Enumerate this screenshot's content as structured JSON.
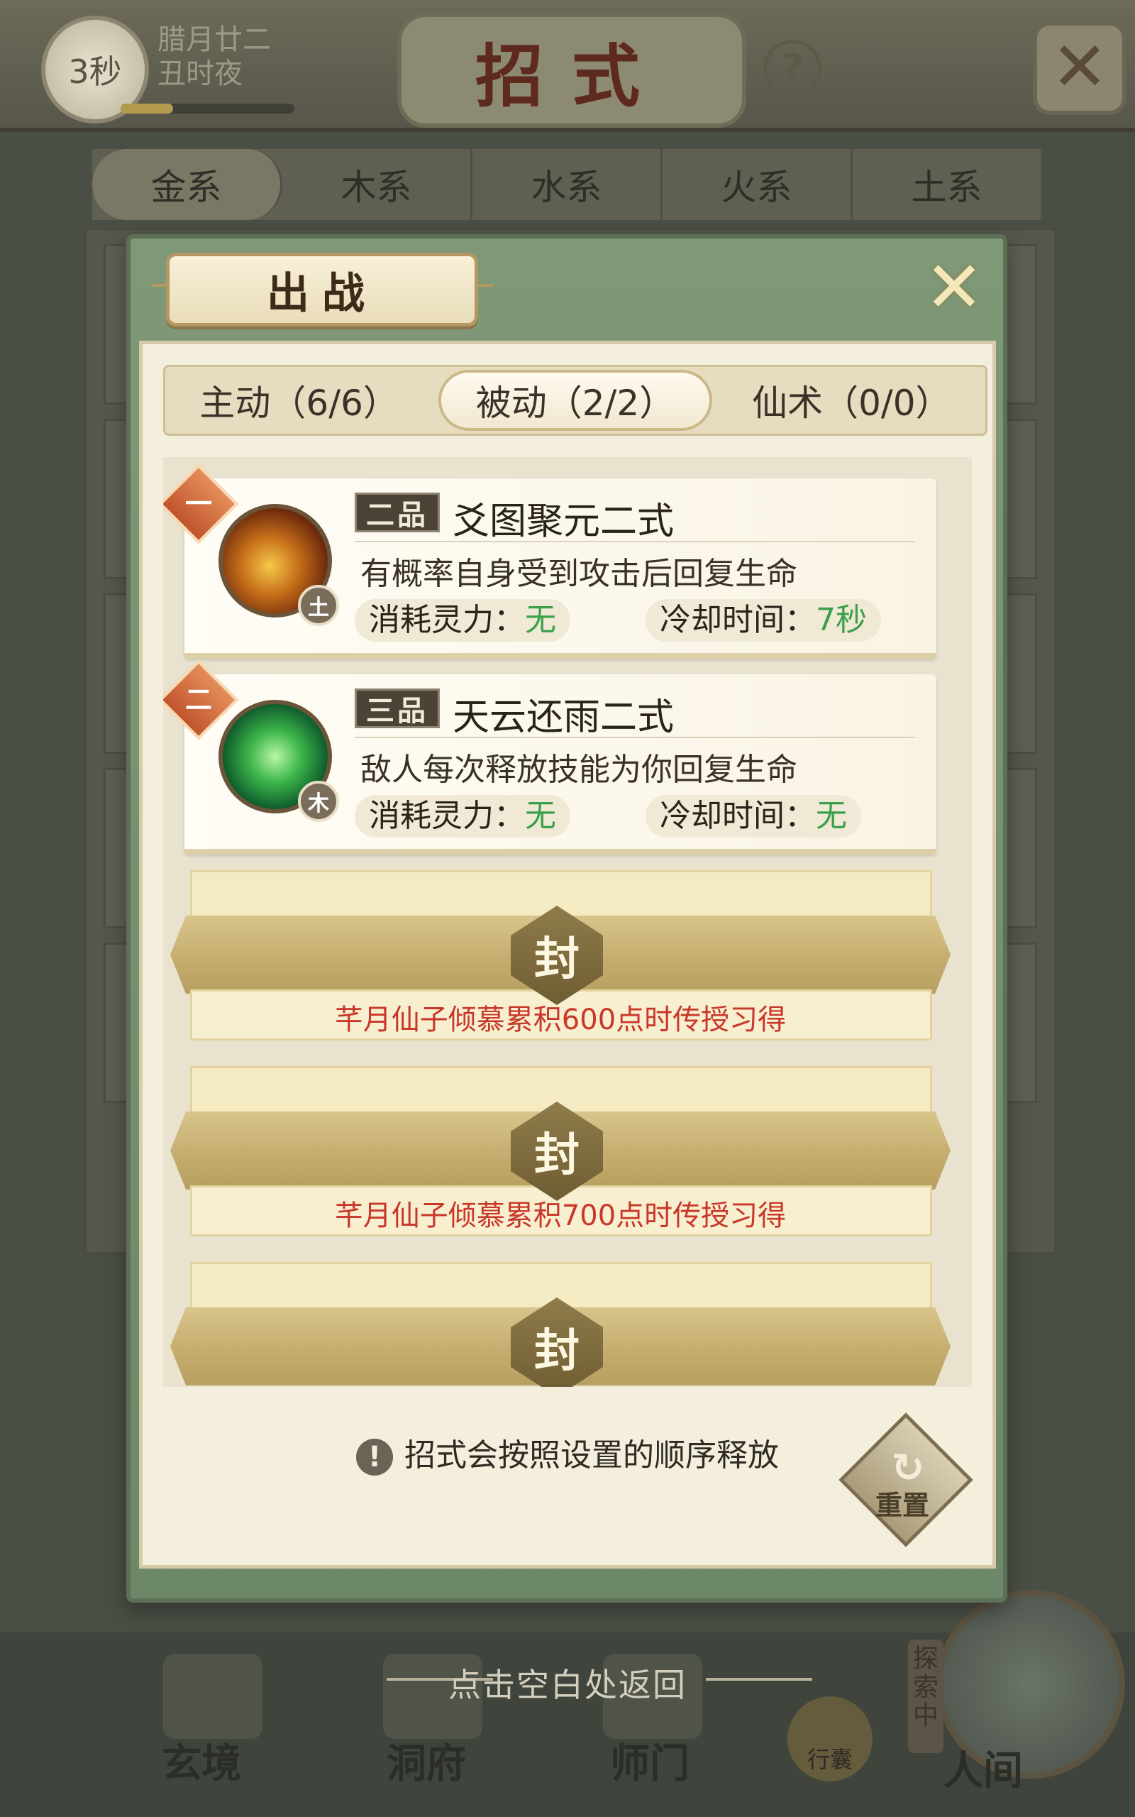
{
  "top_bar": {
    "timer": "3秒",
    "date_line1": "腊月廿二",
    "date_line2": "丑时夜",
    "time_progress": 0.3,
    "title": "招式",
    "help_glyph": "?",
    "close_glyph": "✕"
  },
  "element_tabs": [
    "金系",
    "木系",
    "水系",
    "火系",
    "土系"
  ],
  "modal": {
    "title": "出战",
    "close_glyph": "✕",
    "sub_tabs": [
      "主动（6/6）",
      "被动（2/2）",
      "仙术（0/0）"
    ],
    "active_sub_tab": 1,
    "skills": [
      {
        "order": "一",
        "grade": "二品",
        "name": "爻图聚元二式",
        "element": "土",
        "icon": "earth-skill-icon",
        "description": "有概率自身受到攻击后回复生命",
        "cost_label": "消耗灵力：",
        "cost_value": "无",
        "cooldown_label": "冷却时间：",
        "cooldown_value": "7秒"
      },
      {
        "order": "二",
        "grade": "三品",
        "name": "天云还雨二式",
        "element": "木",
        "icon": "wood-skill-icon",
        "description": "敌人每次释放技能为你回复生命",
        "cost_label": "消耗灵力：",
        "cost_value": "无",
        "cooldown_label": "冷却时间：",
        "cooldown_value": "无"
      }
    ],
    "sealed_slots": [
      {
        "seal": "封",
        "unlock": "芊月仙子倾慕累积600点时传授习得"
      },
      {
        "seal": "封",
        "unlock": "芊月仙子倾慕累积700点时传授习得"
      },
      {
        "seal": "封",
        "unlock": ""
      }
    ],
    "tip": "招式会按照设置的顺序释放",
    "tip_icon": "!",
    "reset_label": "重置",
    "reset_glyph": "↻"
  },
  "dismiss_hint": "点击空白处返回",
  "bottom_nav": {
    "items": [
      "玄境",
      "洞府",
      "师门"
    ],
    "bag": "行囊",
    "explore_tag": "探索中",
    "world": "人间"
  },
  "colors": {
    "modal_green": "#7e9878",
    "paper": "#f4efdd",
    "stat_green": "#3aa14a",
    "unlock_red": "#c9372a"
  }
}
